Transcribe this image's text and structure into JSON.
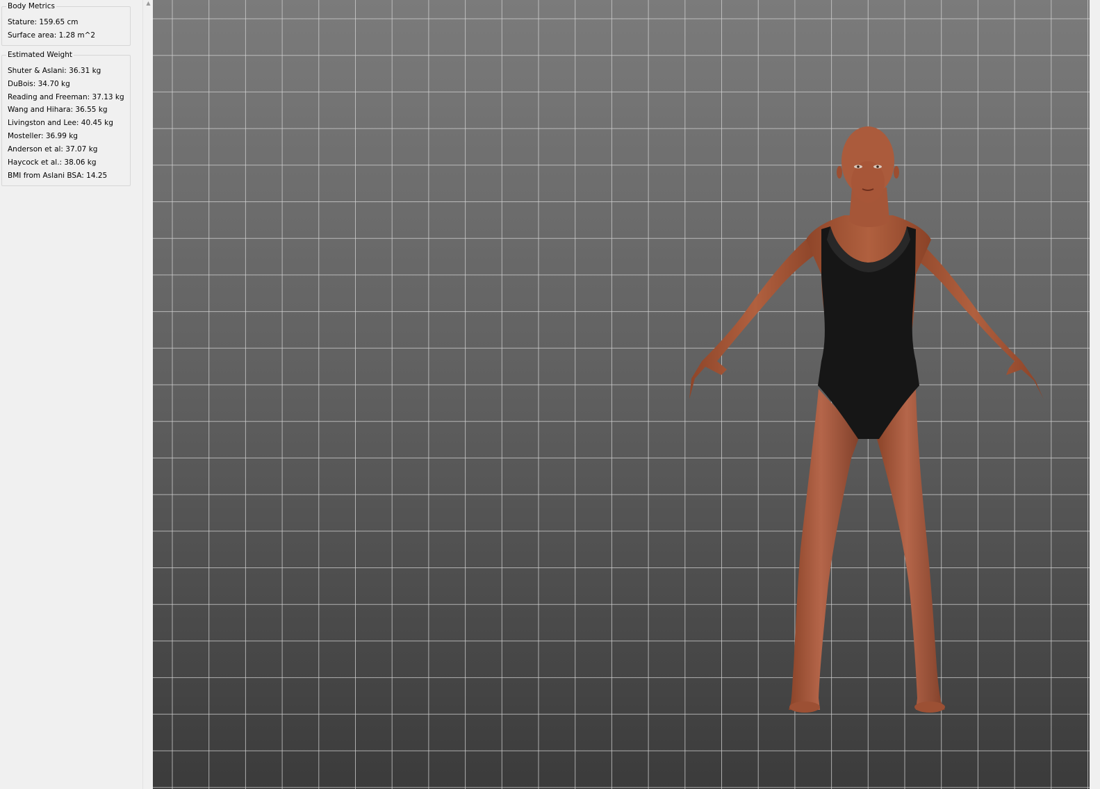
{
  "body_metrics": {
    "title": "Body Metrics",
    "stature": "Stature: 159.65 cm",
    "surface_area": "Surface area: 1.28 m^2"
  },
  "estimated_weight": {
    "title": "Estimated Weight",
    "items": [
      "Shuter & Aslani: 36.31 kg",
      "DuBois: 34.70 kg",
      "Reading and Freeman: 37.13 kg",
      "Wang and Hihara: 36.55 kg",
      "Livingston and Lee: 40.45 kg",
      "Mosteller: 36.99 kg",
      "Anderson et al: 37.07 kg",
      "Haycock et al.: 38.06 kg",
      "BMI from Aslani BSA: 14.25"
    ]
  },
  "scroll_up_icon": "chevron-up-icon",
  "colors": {
    "skin": "#a9583a",
    "swimsuit": "#161616",
    "grid_line": "#d4d4d4",
    "panel_bg": "#f0f0f0"
  }
}
